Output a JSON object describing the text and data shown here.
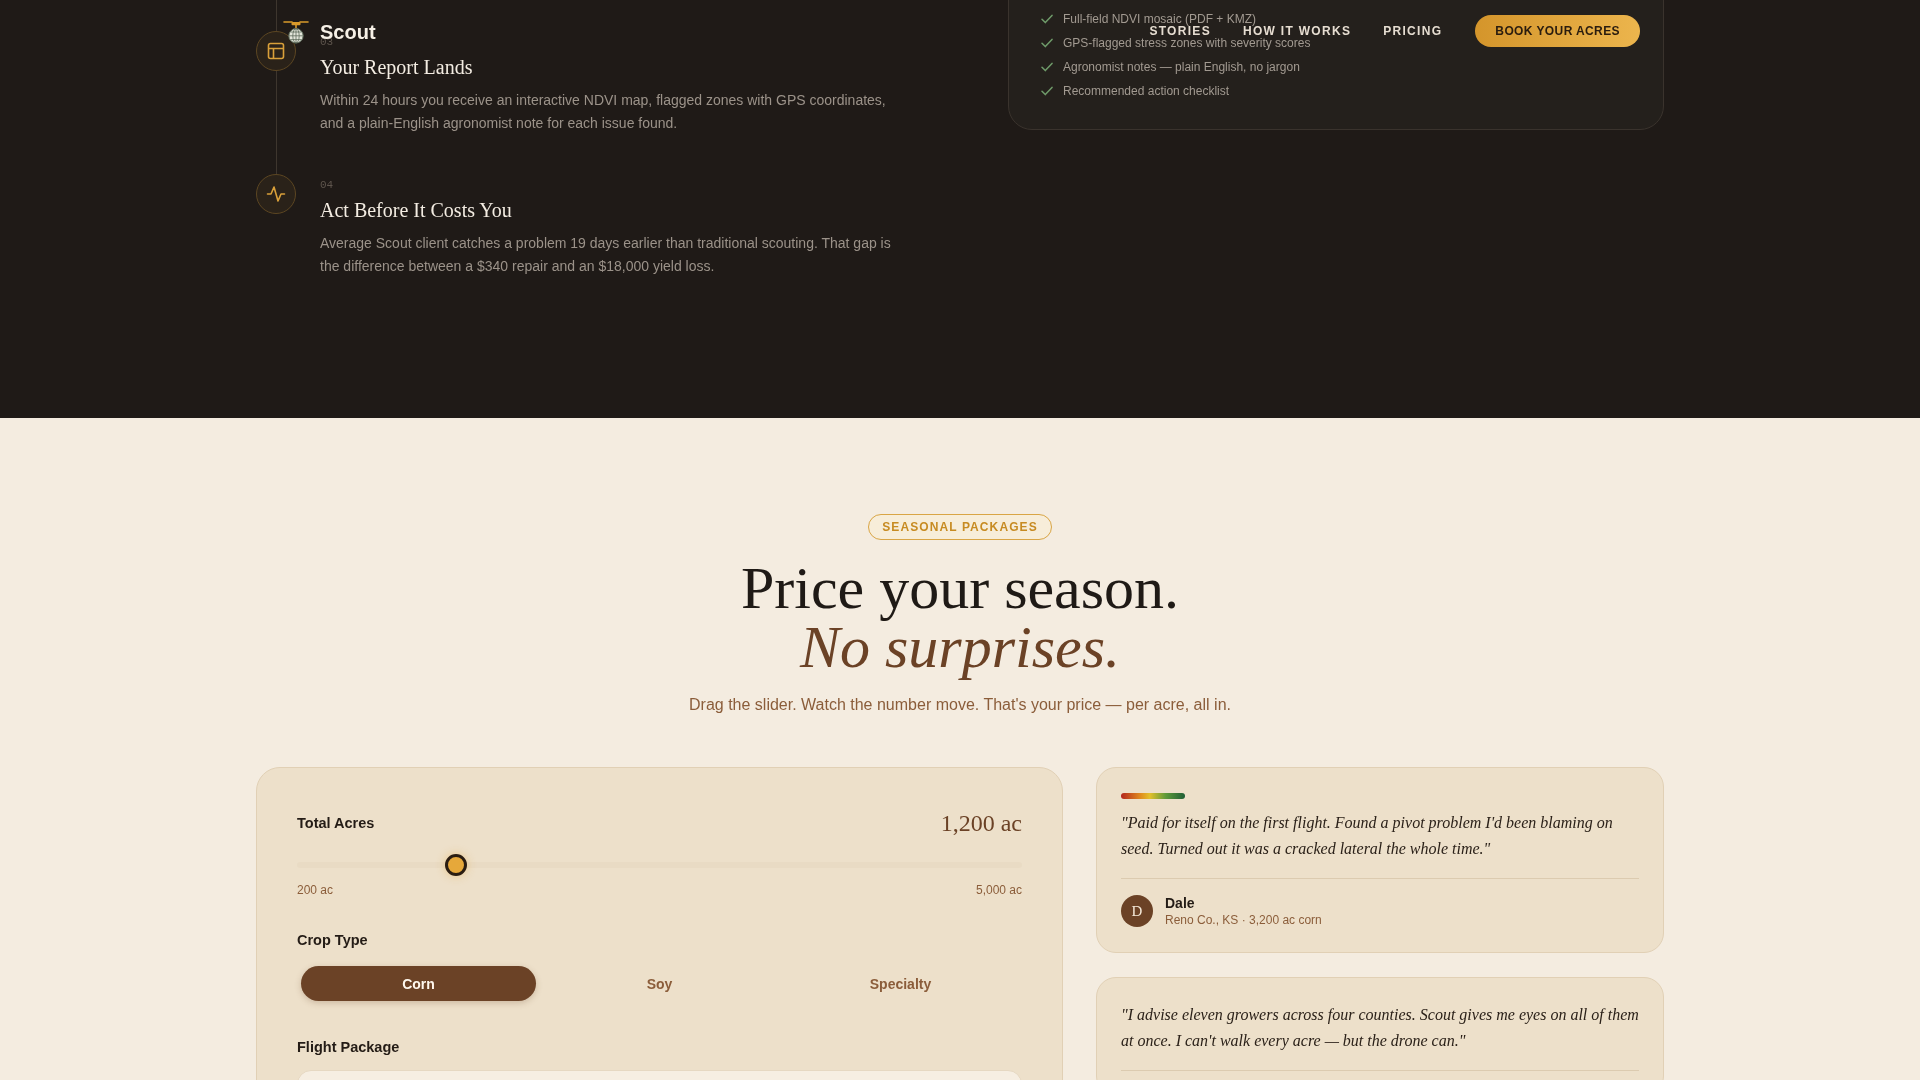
{
  "nav": {
    "logo": "Scout",
    "links": [
      "STORIES",
      "HOW IT WORKS",
      "PRICING"
    ],
    "cta": "BOOK YOUR ACRES"
  },
  "steps": [
    {
      "number": "03",
      "title": "Your Report Lands",
      "description": "Within 24 hours you receive an interactive NDVI map, flagged zones with GPS coordinates, and a plain-English agronomist note for each issue found."
    },
    {
      "number": "04",
      "title": "Act Before It Costs You",
      "description": "Average Scout client catches a problem 19 days earlier than traditional scouting. That gap is the difference between a $340 repair and an $18,000 yield loss."
    }
  ],
  "deliverables": [
    "Full-field NDVI mosaic (PDF + KMZ)",
    "GPS-flagged stress zones with severity scores",
    "Agronomist notes — plain English, no jargon",
    "Recommended action checklist"
  ],
  "pricing": {
    "badge": "SEASONAL PACKAGES",
    "heading": "Price your season.",
    "heading_accent": "No surprises.",
    "subtitle": "Drag the slider. Watch the number move. That's your price — per acre, all in.",
    "calculator": {
      "acres": {
        "label": "Total Acres",
        "value": "1,200 ac",
        "level": 0.21,
        "min_label": "200 ac",
        "max_label": "5,000 ac"
      },
      "crop_type": {
        "label": "Crop Type",
        "options": [
          {
            "label": "Corn",
            "selected": true
          },
          {
            "label": "Soy",
            "selected": false
          },
          {
            "label": "Specialty",
            "selected": false
          }
        ]
      },
      "flight_package": {
        "label": "Flight Package"
      }
    },
    "testimonials": [
      {
        "featured": true,
        "quote": "\"Paid for itself on the first flight. Found a pivot problem I'd been blaming on seed. Turned out it was a cracked lateral the whole time.\"",
        "author": {
          "initial": "D",
          "name": "Dale",
          "details": "Reno Co., KS · 3,200 ac corn"
        }
      },
      {
        "featured": false,
        "quote": "\"I advise eleven growers across four counties. Scout gives me eyes on all of them at once. I can't walk every acre — but the drone can.\""
      }
    ]
  }
}
